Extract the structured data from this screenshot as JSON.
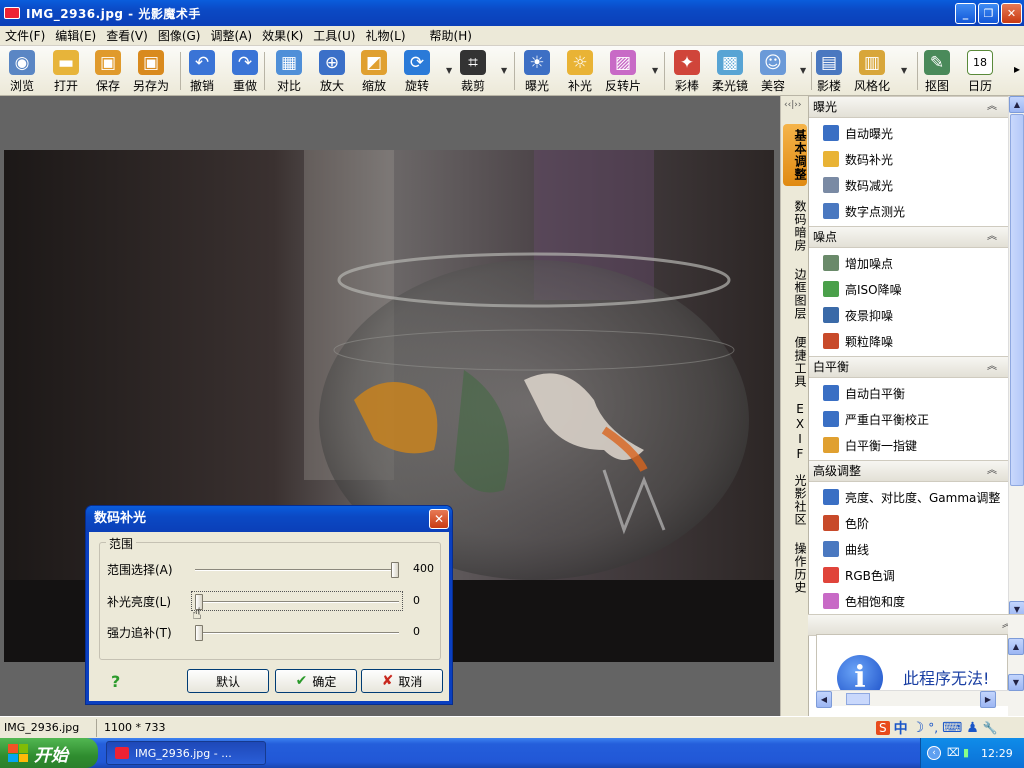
{
  "window": {
    "title": "IMG_2936.jpg - 光影魔术手",
    "min": "_",
    "max": "❐",
    "close": "✕"
  },
  "menu": [
    "文件(F)",
    "编辑(E)",
    "查看(V)",
    "图像(G)",
    "调整(A)",
    "效果(K)",
    "工具(U)",
    "礼物(L)",
    "帮助(H)"
  ],
  "toolbar": [
    {
      "label": "浏览",
      "icon": "browse-icon",
      "color": "#5a86c4",
      "glyph": "◉"
    },
    {
      "label": "打开",
      "icon": "open-folder-icon",
      "color": "#e7b43a",
      "glyph": "▬"
    },
    {
      "label": "保存",
      "icon": "save-icon",
      "color": "#e09a2c",
      "glyph": "▣"
    },
    {
      "label": "另存为",
      "icon": "save-as-icon",
      "color": "#d98a1e",
      "glyph": "▣"
    },
    {
      "label": "撤销",
      "icon": "undo-icon",
      "color": "#3a74d6",
      "glyph": "↶"
    },
    {
      "label": "重做",
      "icon": "redo-icon",
      "color": "#3a74d6",
      "glyph": "↷"
    },
    {
      "label": "对比",
      "icon": "compare-icon",
      "color": "#4f8fd8",
      "glyph": "▦"
    },
    {
      "label": "放大",
      "icon": "zoom-in-icon",
      "color": "#3b70c8",
      "glyph": "⊕"
    },
    {
      "label": "缩放",
      "icon": "resize-icon",
      "color": "#e0a030",
      "glyph": "◩"
    },
    {
      "label": "旋转",
      "icon": "rotate-icon",
      "color": "#2a7ad8",
      "glyph": "⟳"
    },
    {
      "label": "裁剪",
      "icon": "crop-icon",
      "color": "#333333",
      "glyph": "⌗"
    },
    {
      "label": "曝光",
      "icon": "exposure-icon",
      "color": "#3d6fc4",
      "glyph": "☀"
    },
    {
      "label": "补光",
      "icon": "fill-light-icon",
      "color": "#e9b335",
      "glyph": "☼"
    },
    {
      "label": "反转片",
      "icon": "reversal-film-icon",
      "color": "#c86ac6",
      "glyph": "▨"
    },
    {
      "label": "彩棒",
      "icon": "color-wand-icon",
      "color": "#d0453a",
      "glyph": "✦"
    },
    {
      "label": "柔光镜",
      "icon": "soft-lens-icon",
      "color": "#58a4d4",
      "glyph": "▩"
    },
    {
      "label": "美容",
      "icon": "beauty-icon",
      "color": "#6b9ad8",
      "glyph": "☺"
    },
    {
      "label": "影楼",
      "icon": "studio-icon",
      "color": "#4a78c0",
      "glyph": "▤"
    },
    {
      "label": "风格化",
      "icon": "stylize-icon",
      "color": "#d8a63a",
      "glyph": "▥"
    },
    {
      "label": "抠图",
      "icon": "cutout-icon",
      "color": "#4a8a5a",
      "glyph": "✎"
    },
    {
      "label": "日历",
      "icon": "calendar-icon",
      "color": "#5a8a3a",
      "glyph": "18"
    }
  ],
  "toolbar_more": "▸",
  "side_tabs": [
    "基本调整",
    "数码暗房",
    "边框图层",
    "便捷工具",
    "EXIF",
    "光影社区",
    "操作历史"
  ],
  "side_toggle": "‹‹|››",
  "panel": {
    "sections": [
      {
        "title": "曝光",
        "items": [
          "自动曝光",
          "数码补光",
          "数码减光",
          "数字点测光"
        ]
      },
      {
        "title": "噪点",
        "items": [
          "增加噪点",
          "高ISO降噪",
          "夜景抑噪",
          "颗粒降噪"
        ]
      },
      {
        "title": "白平衡",
        "items": [
          "自动白平衡",
          "严重白平衡校正",
          "白平衡一指键"
        ]
      },
      {
        "title": "高级调整",
        "items": [
          "亮度、对比度、Gamma调整",
          "色阶",
          "曲线",
          "RGB色调",
          "色相饱和度"
        ]
      }
    ],
    "chevron": "︽",
    "info_text": "此程序无法!",
    "info_icon_glyph": "i"
  },
  "status": {
    "file": "IMG_2936.jpg",
    "size": "1100 * 733"
  },
  "ime": [
    "S",
    "中",
    "☽",
    "°,",
    "⌨",
    "♟",
    "🔧"
  ],
  "taskbar": {
    "start": "开始",
    "task": "IMG_2936.jpg - ...",
    "clock": "12:29"
  },
  "dialog": {
    "title": "数码补光",
    "close": "✕",
    "group": "范围",
    "sliders": [
      {
        "label": "范围选择(A)",
        "value": "400",
        "fraction": 1.0
      },
      {
        "label": "补光亮度(L)",
        "value": "0",
        "fraction": 0.0
      },
      {
        "label": "强力追补(T)",
        "value": "0",
        "fraction": 0.0
      }
    ],
    "help": "?",
    "buttons": {
      "default": "默认",
      "ok": "确定",
      "cancel": "取消"
    },
    "ok_glyph": "✔",
    "cancel_glyph": "✘"
  }
}
